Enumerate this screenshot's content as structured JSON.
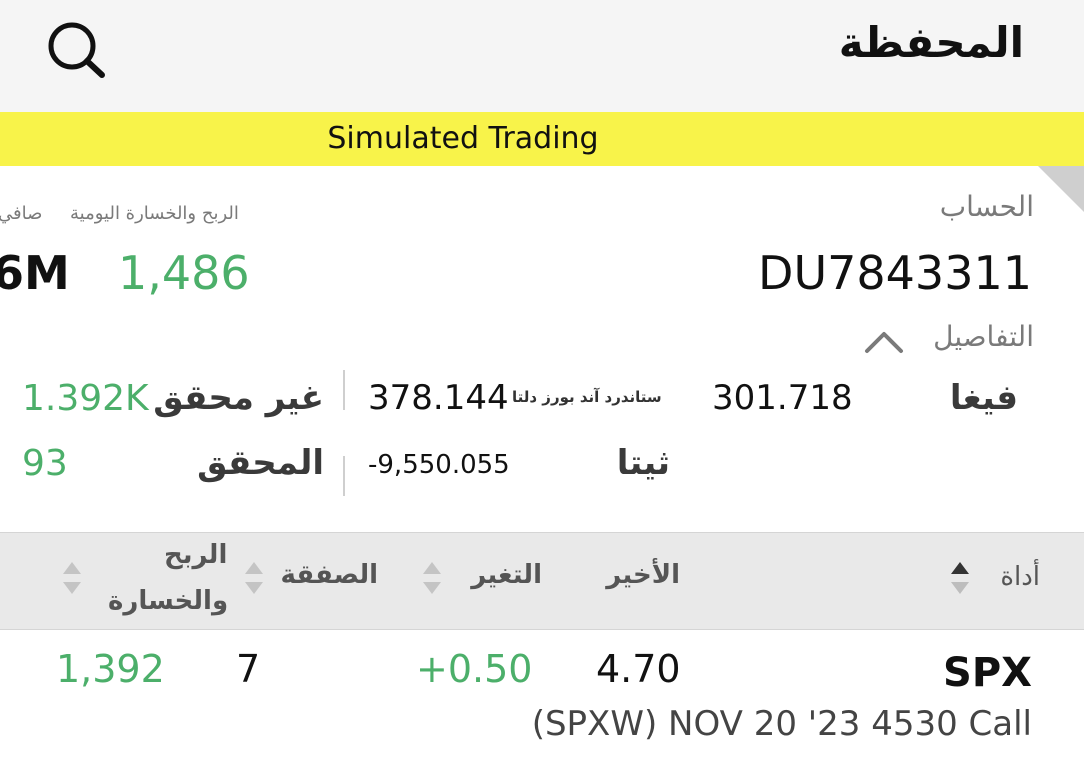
{
  "header": {
    "title": "المحفظة"
  },
  "banner": {
    "text": "Simulated Trading"
  },
  "account": {
    "label": "الحساب",
    "number": "DU7843311",
    "daily_pnl_label": "الربح والخسارة اليومية",
    "daily_pnl_value": "1,486",
    "net_label": "صافي",
    "net_value": "6M"
  },
  "details": {
    "toggle_label": "التفاصيل",
    "vega_label": "فيغا",
    "vega_value": "301.718",
    "delta_label": "ستاندرد آند بورز دلتا",
    "delta_value": "378.144",
    "theta_label": "ثيتا",
    "theta_value": "-9,550.055",
    "unrealized_label": "غير محقق",
    "unrealized_value": "1.392K",
    "realized_label": "المحقق",
    "realized_value": "93"
  },
  "table": {
    "columns": {
      "instrument": "أداة",
      "last": "الأخير",
      "change": "التغير",
      "position": "الصفقة",
      "pnl_line1": "الربح",
      "pnl_line2": "والخسارة"
    },
    "rows": [
      {
        "symbol": "SPX",
        "description": "(SPXW) NOV 20 '23 4530 Call",
        "last": "4.70",
        "change": "+0.50",
        "position": "7",
        "pnl": "1,392"
      }
    ]
  },
  "colors": {
    "banner": "#f8f34a",
    "positive": "#4caf6a",
    "highlight": "#f8f4a4"
  },
  "icons": {
    "search": "search-icon",
    "details_toggle": "chevron-up-icon",
    "sort": "sort-arrows-icon"
  }
}
